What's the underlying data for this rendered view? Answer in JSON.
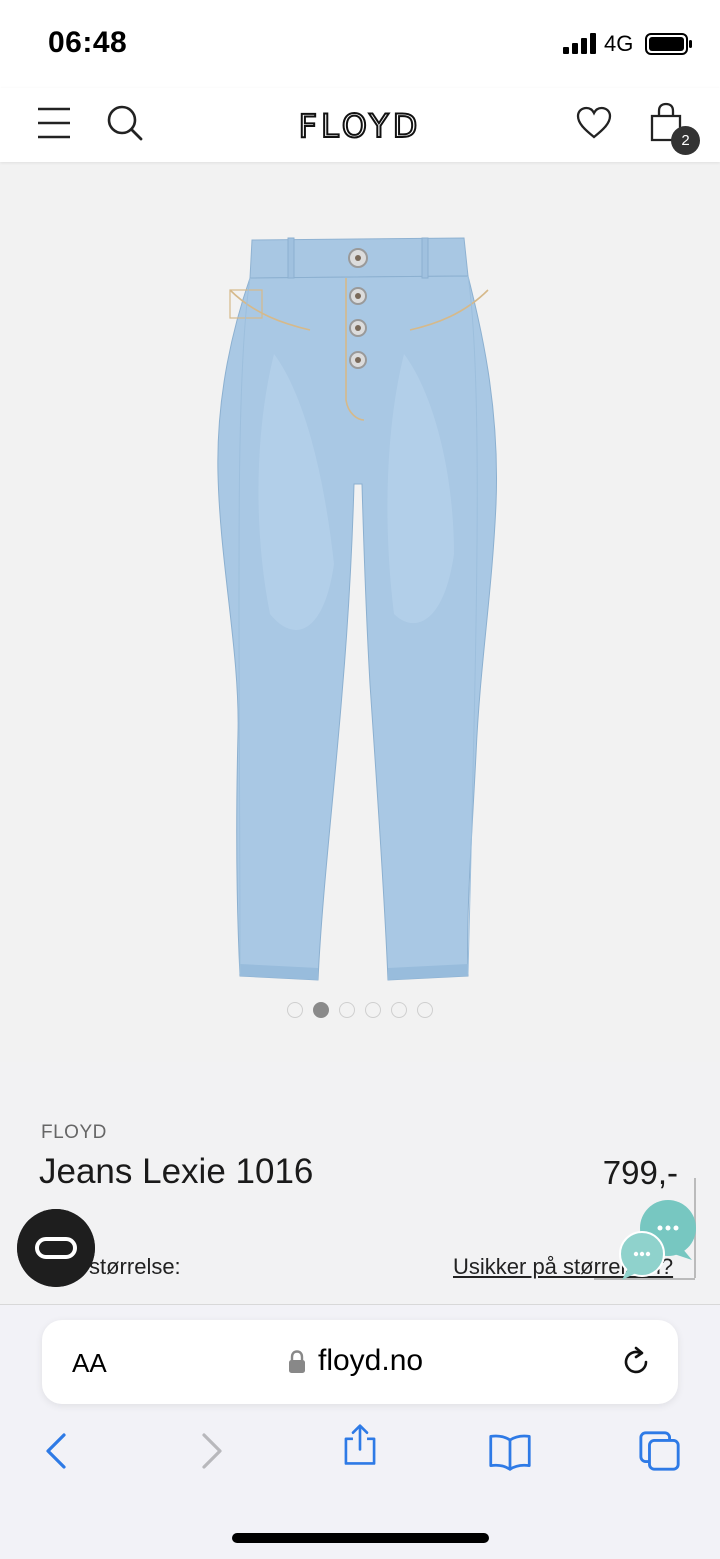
{
  "status_bar": {
    "time": "06:48",
    "network": "4G"
  },
  "header": {
    "logo": "FLOYD",
    "cart_count": "2"
  },
  "gallery": {
    "image_count": 6,
    "active_index": 1
  },
  "product": {
    "brand": "FLOYD",
    "name": "Jeans Lexie 1016",
    "price": "799,-",
    "size_label": "størrelse:",
    "size_help_link": "Usikker på størrelsen?"
  },
  "browser": {
    "aa_label": "AA",
    "url": "floyd.no"
  },
  "colors": {
    "denim": "#a9c8e4",
    "background": "#f2f2f2",
    "browser_accent": "#2e7ae6",
    "chat": "#77c7c1"
  },
  "icons": [
    "menu-icon",
    "search-icon",
    "heart-icon",
    "bag-icon",
    "lock-icon",
    "reload-icon",
    "back-icon",
    "forward-icon",
    "share-icon",
    "book-icon",
    "tabs-icon",
    "chat-icon",
    "accessibility-icon"
  ]
}
